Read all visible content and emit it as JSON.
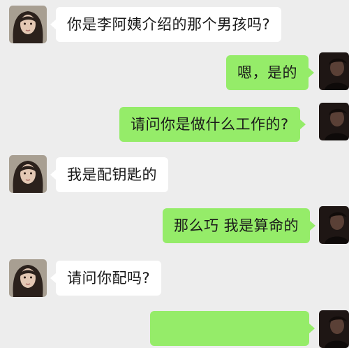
{
  "chat": {
    "messages": [
      {
        "side": "left",
        "text": "你是李阿姨介绍的那个男孩吗?"
      },
      {
        "side": "right",
        "text": "嗯，是的"
      },
      {
        "side": "right",
        "text": "请问你是做什么工作的?"
      },
      {
        "side": "left",
        "text": "我是配钥匙的"
      },
      {
        "side": "right",
        "text": "那么巧 我是算命的"
      },
      {
        "side": "left",
        "text": "请问你配吗?"
      },
      {
        "side": "right",
        "text": ""
      }
    ]
  },
  "colors": {
    "background": "#ededed",
    "bubble_left": "#ffffff",
    "bubble_right": "#95ec69"
  },
  "icons": {
    "left_avatar": "girl-avatar",
    "right_avatar": "boy-avatar"
  }
}
